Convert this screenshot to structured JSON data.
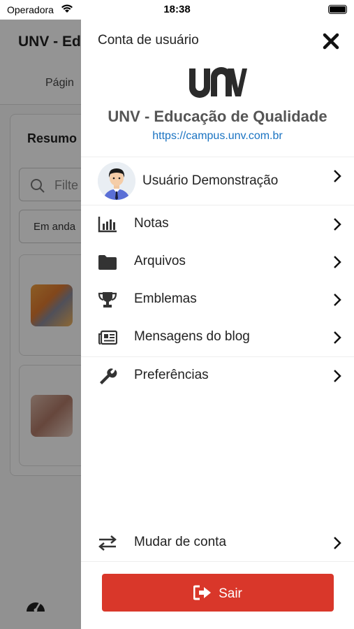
{
  "status_bar": {
    "carrier": "Operadora",
    "time": "18:38"
  },
  "background": {
    "app_title": "UNV - Ed",
    "tab_label": "Págin",
    "card_title": "Resumo",
    "filter_placeholder": "Filte",
    "select_value": "Em anda"
  },
  "drawer": {
    "title": "Conta de usuário",
    "site_name": "UNV - Educação de Qualidade",
    "site_url": "https://campus.unv.com.br",
    "user_name": "Usuário Demonstração",
    "menu": [
      {
        "label": "Notas",
        "icon": "chart-bar-icon"
      },
      {
        "label": "Arquivos",
        "icon": "folder-icon"
      },
      {
        "label": "Emblemas",
        "icon": "trophy-icon"
      },
      {
        "label": "Mensagens do blog",
        "icon": "newspaper-icon"
      },
      {
        "label": "Preferências",
        "icon": "wrench-icon"
      }
    ],
    "switch_account_label": "Mudar de conta",
    "logout_label": "Sair"
  },
  "colors": {
    "accent_red": "#d9372a",
    "link_blue": "#1a73c2"
  }
}
